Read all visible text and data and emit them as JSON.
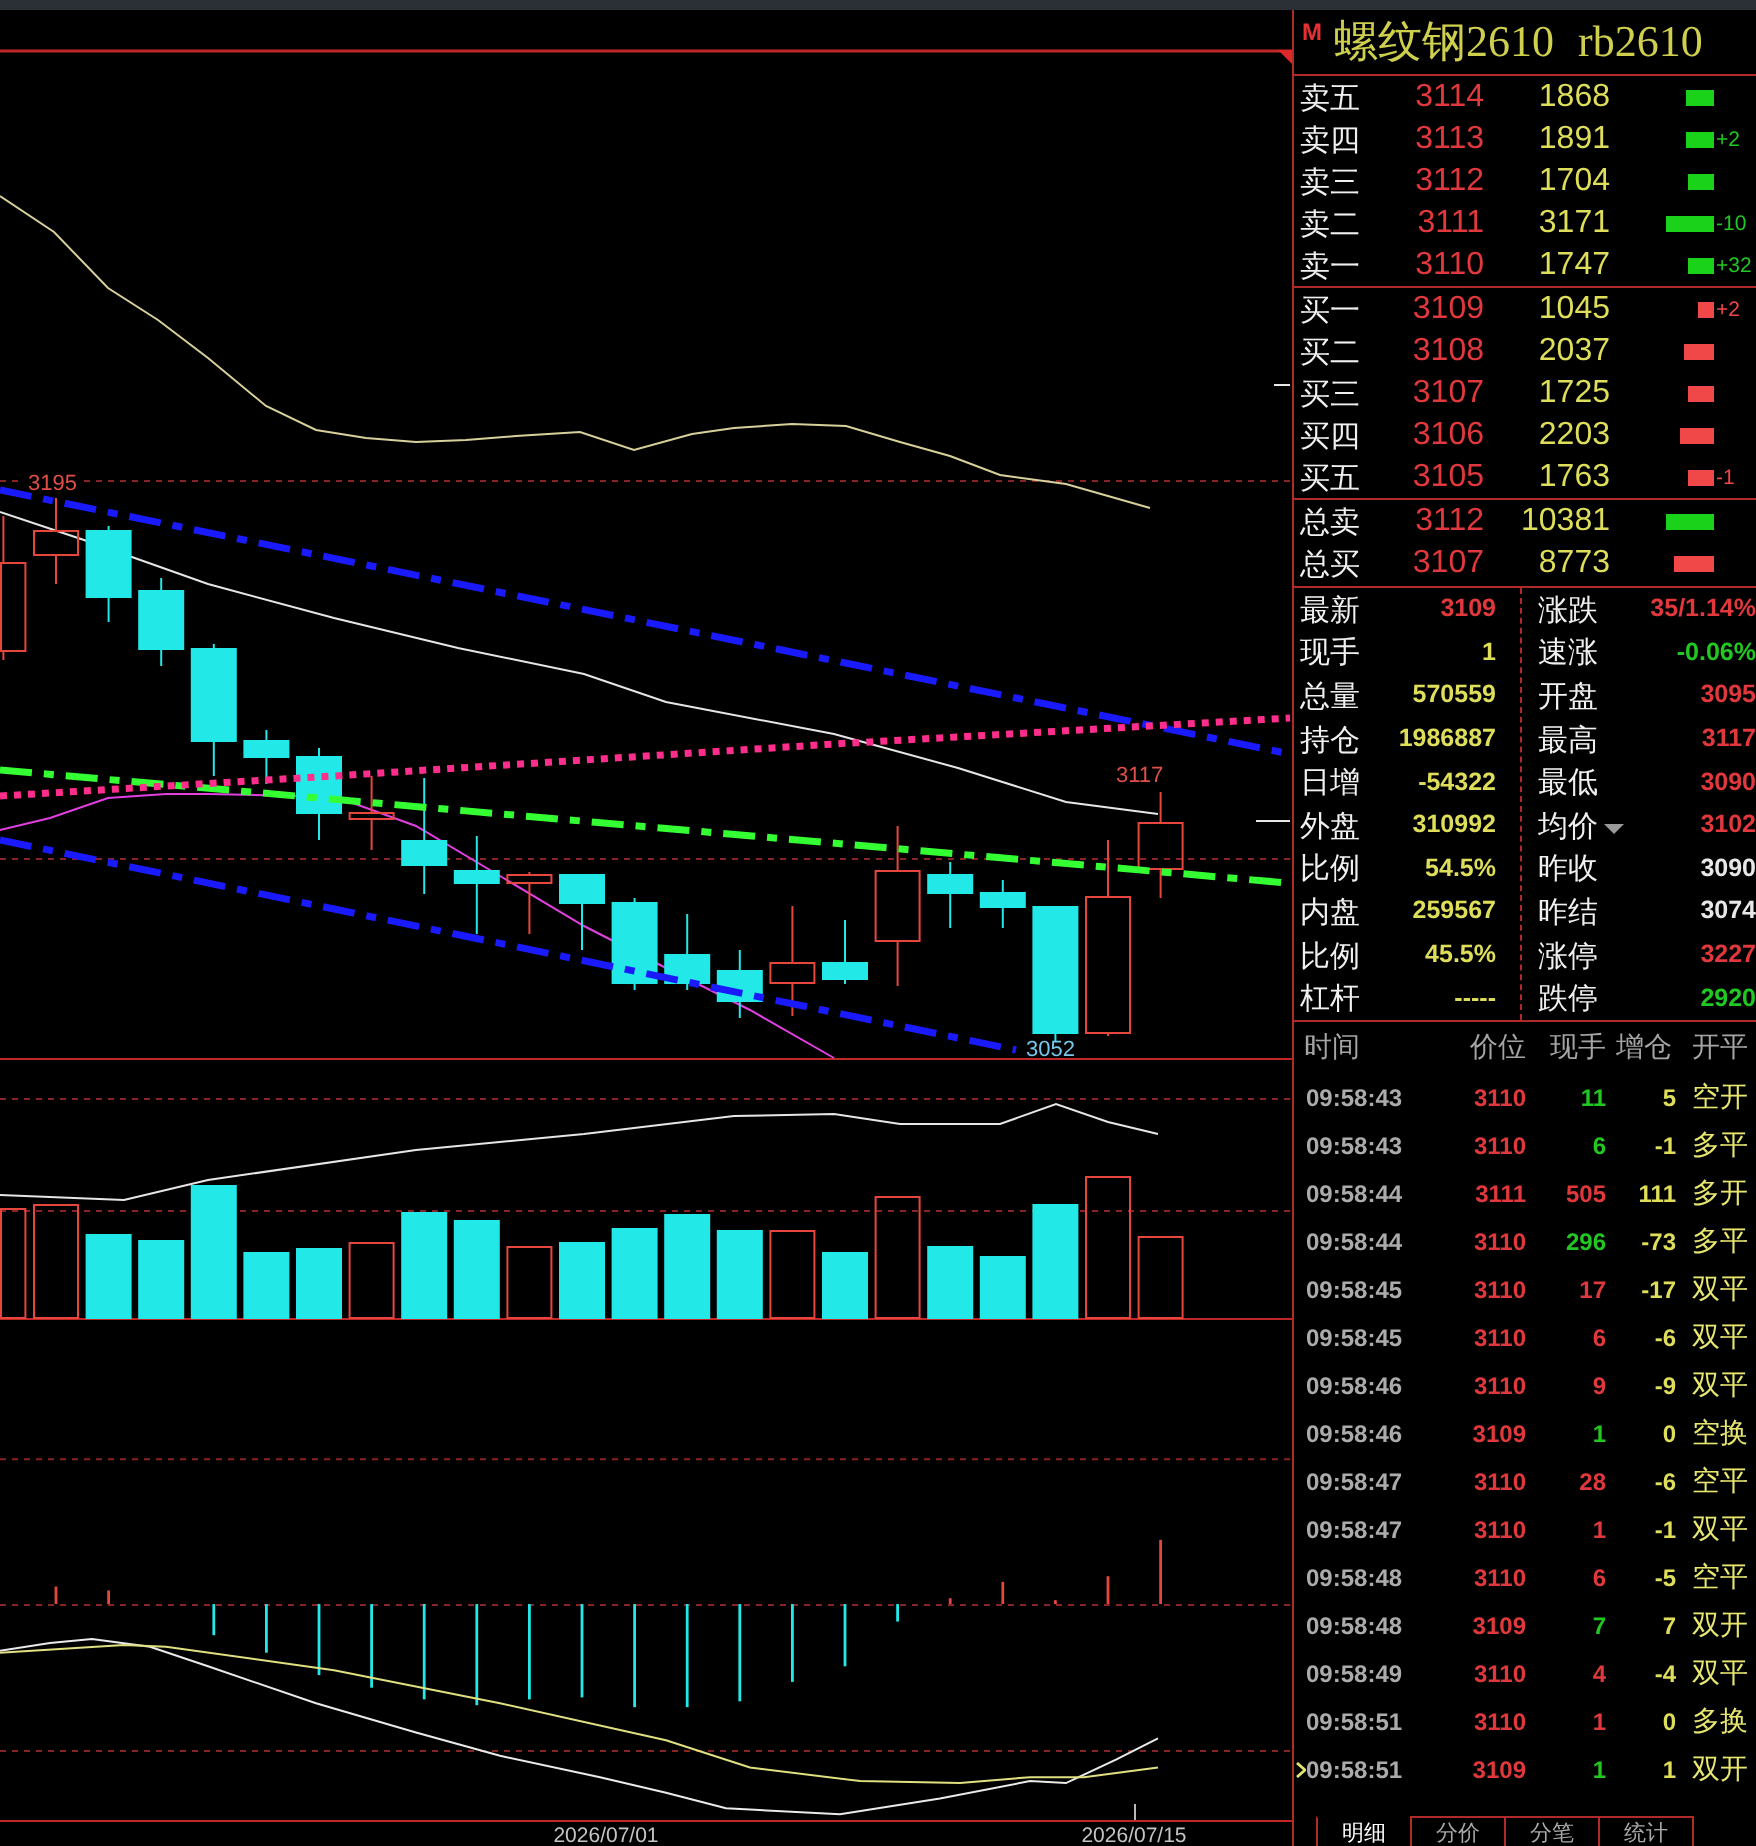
{
  "chart": {
    "high_label": "3195",
    "recent_high_label": "3117",
    "low_label": "3052",
    "date_labels": [
      "2026/07/01",
      "2026/07/15"
    ]
  },
  "quote": {
    "marker": "M",
    "name": "螺纹钢2610",
    "code": "rb2610"
  },
  "asks": [
    {
      "label": "卖五",
      "price": "3114",
      "volume": "1868"
    },
    {
      "label": "卖四",
      "price": "3113",
      "volume": "1891",
      "change": "+2"
    },
    {
      "label": "卖三",
      "price": "3112",
      "volume": "1704"
    },
    {
      "label": "卖二",
      "price": "3111",
      "volume": "3171",
      "change": "-10"
    },
    {
      "label": "卖一",
      "price": "3110",
      "volume": "1747",
      "change": "+32"
    }
  ],
  "bids": [
    {
      "label": "买一",
      "price": "3109",
      "volume": "1045",
      "change": "+2"
    },
    {
      "label": "买二",
      "price": "3108",
      "volume": "2037"
    },
    {
      "label": "买三",
      "price": "3107",
      "volume": "1725"
    },
    {
      "label": "买四",
      "price": "3106",
      "volume": "2203"
    },
    {
      "label": "买五",
      "price": "3105",
      "volume": "1763",
      "change": "-1"
    }
  ],
  "totals": [
    {
      "label": "总卖",
      "price": "3112",
      "volume": "10381",
      "kind": "sell"
    },
    {
      "label": "总买",
      "price": "3107",
      "volume": "8773",
      "kind": "buy"
    }
  ],
  "stats_left": [
    {
      "label": "最新",
      "value": "3109",
      "color": "#e0383c"
    },
    {
      "label": "现手",
      "value": "1",
      "color": "#dede5a"
    },
    {
      "label": "总量",
      "value": "570559",
      "color": "#dede5a"
    },
    {
      "label": "持仓",
      "value": "1986887",
      "color": "#dede5a"
    },
    {
      "label": "日增",
      "value": "-54322",
      "color": "#dede5a"
    },
    {
      "label": "外盘",
      "value": "310992",
      "color": "#dede5a"
    },
    {
      "label": "比例",
      "value": "54.5%",
      "color": "#dede5a"
    },
    {
      "label": "内盘",
      "value": "259567",
      "color": "#dede5a"
    },
    {
      "label": "比例",
      "value": "45.5%",
      "color": "#dede5a"
    },
    {
      "label": "杠杆",
      "value": "-----",
      "color": "#dede5a"
    }
  ],
  "stats_right": [
    {
      "label": "涨跌",
      "value": "35/1.14%",
      "color": "#e0383c",
      "dropdown": false
    },
    {
      "label": "速涨",
      "value": "-0.06%",
      "color": "#22c822",
      "dropdown": false
    },
    {
      "label": "开盘",
      "value": "3095",
      "color": "#e0383c",
      "dropdown": false
    },
    {
      "label": "最高",
      "value": "3117",
      "color": "#e0383c",
      "dropdown": false
    },
    {
      "label": "最低",
      "value": "3090",
      "color": "#e0383c",
      "dropdown": false
    },
    {
      "label": "均价",
      "value": "3102",
      "color": "#e0383c",
      "dropdown": true
    },
    {
      "label": "昨收",
      "value": "3090",
      "color": "#e8e8e8",
      "dropdown": false
    },
    {
      "label": "昨结",
      "value": "3074",
      "color": "#e8e8e8",
      "dropdown": false
    },
    {
      "label": "涨停",
      "value": "3227",
      "color": "#e0383c",
      "dropdown": false
    },
    {
      "label": "跌停",
      "value": "2920",
      "color": "#22c822",
      "dropdown": false
    }
  ],
  "trades": {
    "columns": [
      "时间",
      "价位",
      "现手",
      "增仓",
      "开平"
    ],
    "rows": [
      {
        "time": "09:58:43",
        "price": "3110",
        "volume": "11",
        "color": "#22c822",
        "change": "5",
        "type": "空开",
        "selected": false
      },
      {
        "time": "09:58:43",
        "price": "3110",
        "volume": "6",
        "color": "#22c822",
        "change": "-1",
        "type": "多平",
        "selected": false
      },
      {
        "time": "09:58:44",
        "price": "3111",
        "volume": "505",
        "color": "#e0383c",
        "change": "111",
        "type": "多开",
        "selected": false
      },
      {
        "time": "09:58:44",
        "price": "3110",
        "volume": "296",
        "color": "#22c822",
        "change": "-73",
        "type": "多平",
        "selected": false
      },
      {
        "time": "09:58:45",
        "price": "3110",
        "volume": "17",
        "color": "#e0383c",
        "change": "-17",
        "type": "双平",
        "selected": false
      },
      {
        "time": "09:58:45",
        "price": "3110",
        "volume": "6",
        "color": "#e0383c",
        "change": "-6",
        "type": "双平",
        "selected": false
      },
      {
        "time": "09:58:46",
        "price": "3110",
        "volume": "9",
        "color": "#e0383c",
        "change": "-9",
        "type": "双平",
        "selected": false
      },
      {
        "time": "09:58:46",
        "price": "3109",
        "volume": "1",
        "color": "#22c822",
        "change": "0",
        "type": "空换",
        "selected": false
      },
      {
        "time": "09:58:47",
        "price": "3110",
        "volume": "28",
        "color": "#e0383c",
        "change": "-6",
        "type": "空平",
        "selected": false
      },
      {
        "time": "09:58:47",
        "price": "3110",
        "volume": "1",
        "color": "#e0383c",
        "change": "-1",
        "type": "双平",
        "selected": false
      },
      {
        "time": "09:58:48",
        "price": "3110",
        "volume": "6",
        "color": "#e0383c",
        "change": "-5",
        "type": "空平",
        "selected": false
      },
      {
        "time": "09:58:48",
        "price": "3109",
        "volume": "7",
        "color": "#22c822",
        "change": "7",
        "type": "双开",
        "selected": false
      },
      {
        "time": "09:58:49",
        "price": "3110",
        "volume": "4",
        "color": "#e0383c",
        "change": "-4",
        "type": "双平",
        "selected": false
      },
      {
        "time": "09:58:51",
        "price": "3110",
        "volume": "1",
        "color": "#e0383c",
        "change": "0",
        "type": "多换",
        "selected": false
      },
      {
        "time": "09:58:51",
        "price": "3109",
        "volume": "1",
        "color": "#22c822",
        "change": "1",
        "type": "双开",
        "selected": true
      }
    ]
  },
  "tabs": [
    {
      "label": "明细",
      "selected": true
    },
    {
      "label": "分价",
      "selected": false
    },
    {
      "label": "分笔",
      "selected": false
    },
    {
      "label": "统计",
      "selected": false
    }
  ]
}
